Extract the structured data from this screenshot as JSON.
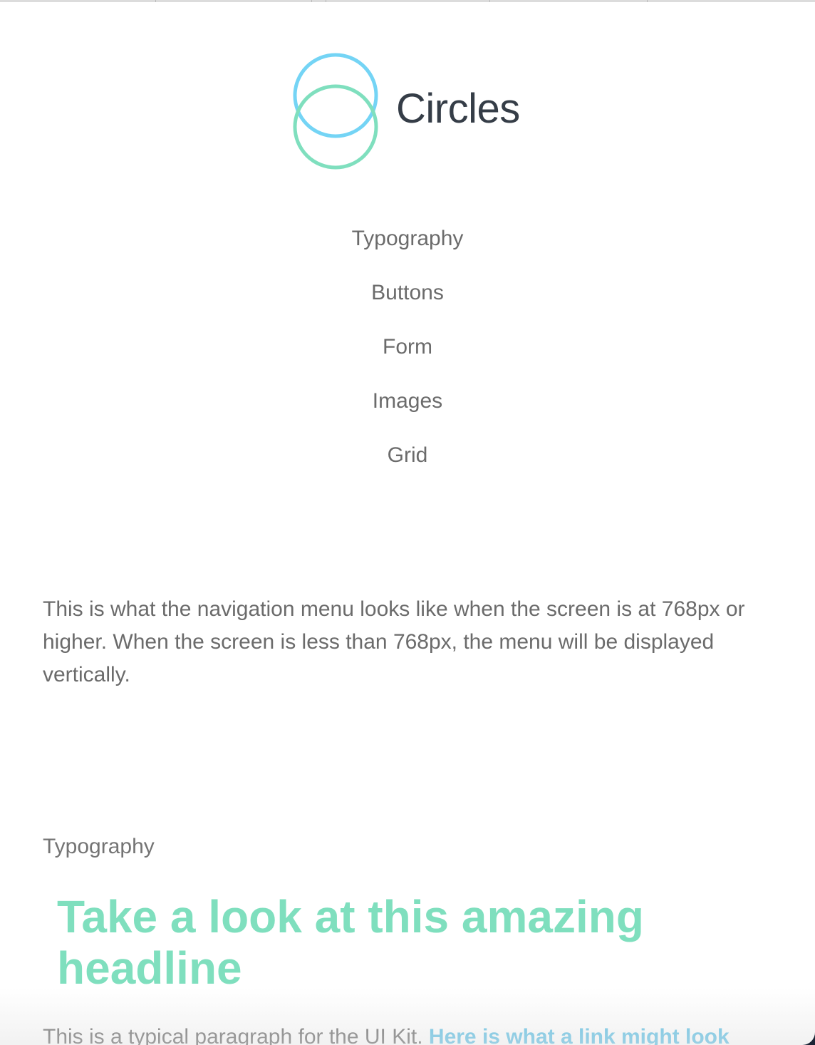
{
  "brand": {
    "name": "Circles",
    "colors": {
      "circle_top": "#74d4f5",
      "circle_bottom": "#7fdfbe",
      "text": "#353d47"
    }
  },
  "nav": {
    "items": [
      {
        "label": "Typography"
      },
      {
        "label": "Buttons"
      },
      {
        "label": "Form"
      },
      {
        "label": "Images"
      },
      {
        "label": "Grid"
      }
    ]
  },
  "note": {
    "text": "This is what the navigation menu looks like when the screen is at 768px or higher. When the screen is less than 768px, the menu will be displayed vertically."
  },
  "typography_section": {
    "label": "Typography",
    "headline": "Take a look at this amazing headline",
    "headline_color": "#7fdfbe",
    "paragraph_text": "This is a typical paragraph for the UI Kit. ",
    "paragraph_link": "Here is what a link might look",
    "link_color": "#62c2e6"
  }
}
